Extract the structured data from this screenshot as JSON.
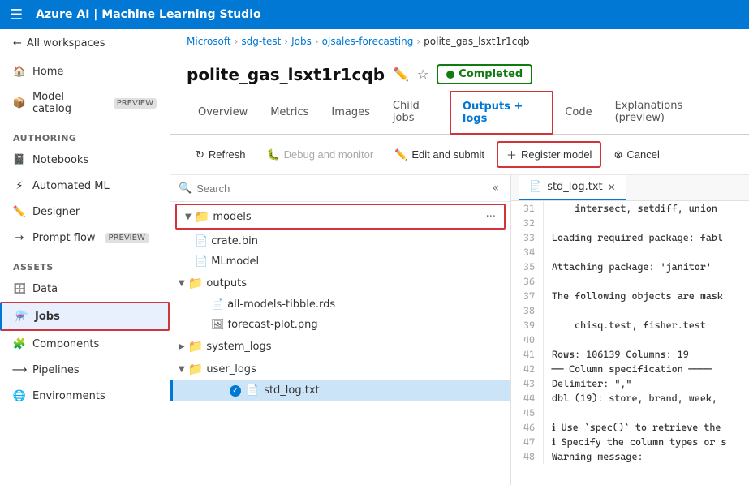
{
  "topbar": {
    "title": "Azure AI | Machine Learning Studio"
  },
  "breadcrumb": {
    "items": [
      "Microsoft",
      "sdg-test",
      "Jobs",
      "ojsales-forecasting",
      "polite_gas_lsxt1r1cqb"
    ]
  },
  "page": {
    "title": "polite_gas_lsxt1r1cqb",
    "status": "Completed"
  },
  "tabs": [
    {
      "id": "overview",
      "label": "Overview"
    },
    {
      "id": "metrics",
      "label": "Metrics"
    },
    {
      "id": "images",
      "label": "Images"
    },
    {
      "id": "child-jobs",
      "label": "Child jobs"
    },
    {
      "id": "outputs-logs",
      "label": "Outputs + logs",
      "active": true
    },
    {
      "id": "code",
      "label": "Code"
    },
    {
      "id": "explanations",
      "label": "Explanations (preview)"
    }
  ],
  "toolbar": {
    "refresh": "Refresh",
    "debug_monitor": "Debug and monitor",
    "edit_submit": "Edit and submit",
    "register_model": "Register model",
    "cancel": "Cancel"
  },
  "file_tree": {
    "search_placeholder": "Search",
    "items": [
      {
        "id": "models",
        "label": "models",
        "type": "folder-yellow",
        "depth": 0,
        "expanded": true,
        "highlighted": true
      },
      {
        "id": "crate.bin",
        "label": "crate.bin",
        "type": "file",
        "depth": 1
      },
      {
        "id": "MLmodel",
        "label": "MLmodel",
        "type": "file",
        "depth": 1
      },
      {
        "id": "outputs",
        "label": "outputs",
        "type": "folder-yellow",
        "depth": 0,
        "expanded": true
      },
      {
        "id": "all-models-tibble.rds",
        "label": "all-models-tibble.rds",
        "type": "file",
        "depth": 2
      },
      {
        "id": "forecast-plot.png",
        "label": "forecast-plot.png",
        "type": "file-img",
        "depth": 2
      },
      {
        "id": "system_logs",
        "label": "system_logs",
        "type": "folder-dark",
        "depth": 0,
        "expanded": false
      },
      {
        "id": "user_logs",
        "label": "user_logs",
        "type": "folder-yellow",
        "depth": 0,
        "expanded": true
      },
      {
        "id": "std_log.txt",
        "label": "std_log.txt",
        "type": "file",
        "depth": 2,
        "active": true
      }
    ]
  },
  "log_file": {
    "name": "std_log.txt",
    "lines": [
      {
        "num": 31,
        "content": "    intersect, setdiff, union"
      },
      {
        "num": 32,
        "content": ""
      },
      {
        "num": 33,
        "content": "Loading required package: fabl"
      },
      {
        "num": 34,
        "content": ""
      },
      {
        "num": 35,
        "content": "Attaching package: 'janitor'"
      },
      {
        "num": 36,
        "content": ""
      },
      {
        "num": 37,
        "content": "The following objects are mask"
      },
      {
        "num": 38,
        "content": ""
      },
      {
        "num": 39,
        "content": "    chisq.test, fisher.test"
      },
      {
        "num": 40,
        "content": ""
      },
      {
        "num": 41,
        "content": "Rows: 106139 Columns: 19"
      },
      {
        "num": 42,
        "content": "── Column specification ────"
      },
      {
        "num": 43,
        "content": "Delimiter: \",\""
      },
      {
        "num": 44,
        "content": "dbl (19): store, brand, week,"
      },
      {
        "num": 45,
        "content": ""
      },
      {
        "num": 46,
        "content": "ℹ Use `spec()` to retrieve the"
      },
      {
        "num": 47,
        "content": "ℹ Specify the column types or s"
      },
      {
        "num": 48,
        "content": "Warning message:"
      }
    ]
  },
  "sidebar": {
    "back_label": "All workspaces",
    "nav_items": [
      {
        "id": "home",
        "label": "Home",
        "icon": "🏠"
      },
      {
        "id": "model-catalog",
        "label": "Model catalog",
        "icon": "📦",
        "badge": "PREVIEW"
      }
    ],
    "authoring_label": "Authoring",
    "authoring_items": [
      {
        "id": "notebooks",
        "label": "Notebooks",
        "icon": "📓"
      },
      {
        "id": "automated-ml",
        "label": "Automated ML",
        "icon": "⚡"
      },
      {
        "id": "designer",
        "label": "Designer",
        "icon": "✏️"
      },
      {
        "id": "prompt-flow",
        "label": "Prompt flow",
        "icon": "→",
        "badge": "PREVIEW"
      }
    ],
    "assets_label": "Assets",
    "assets_items": [
      {
        "id": "data",
        "label": "Data",
        "icon": "🗄"
      },
      {
        "id": "jobs",
        "label": "Jobs",
        "icon": "⚗️",
        "active": true
      },
      {
        "id": "components",
        "label": "Components",
        "icon": "🧩"
      },
      {
        "id": "pipelines",
        "label": "Pipelines",
        "icon": "⟶"
      },
      {
        "id": "environments",
        "label": "Environments",
        "icon": "🌐"
      }
    ]
  }
}
